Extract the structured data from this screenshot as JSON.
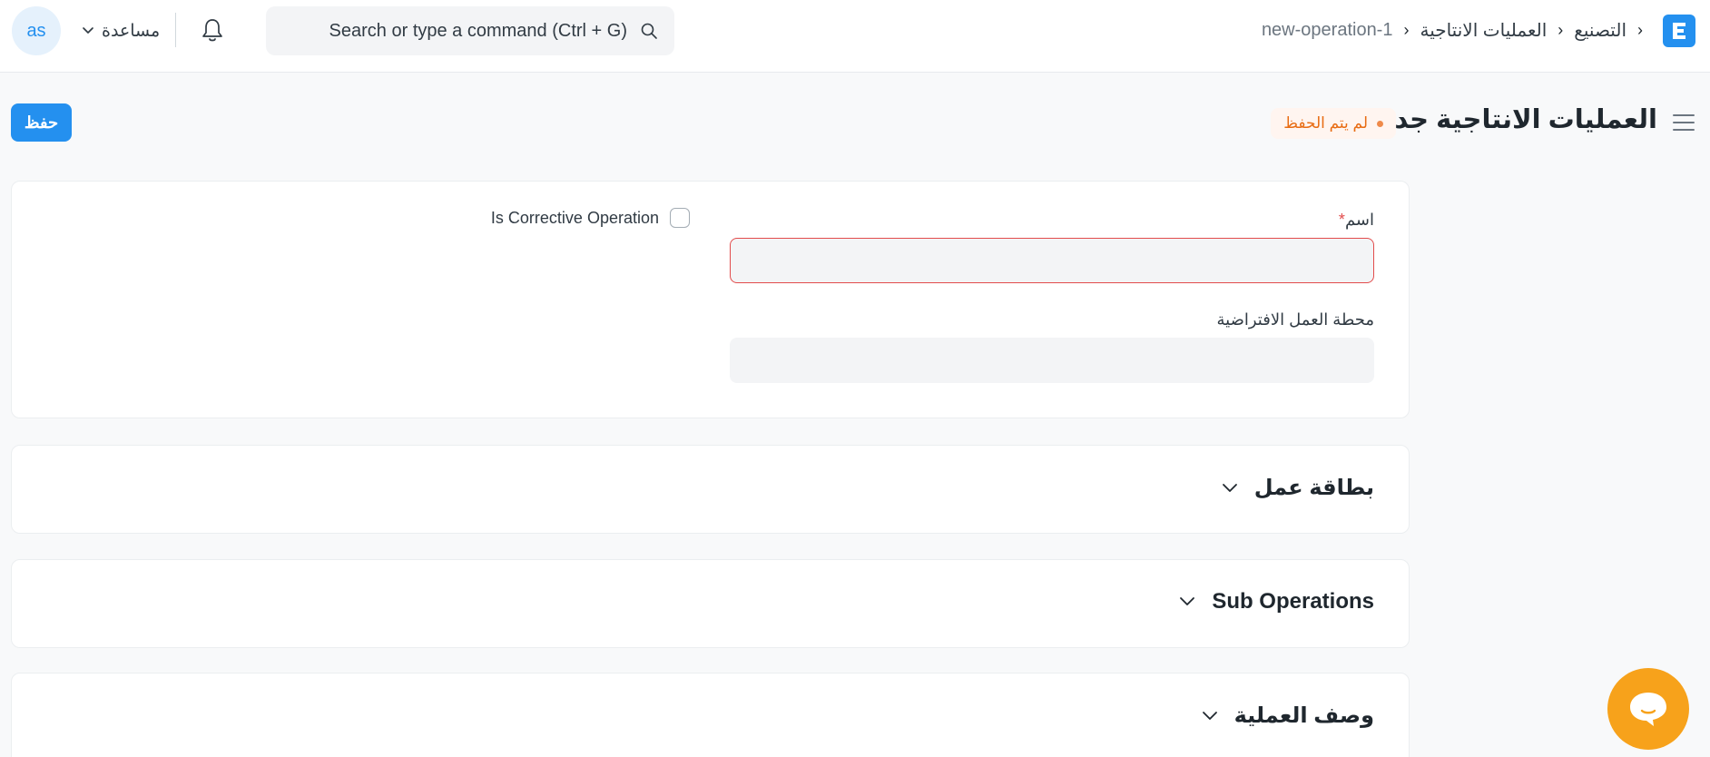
{
  "navbar": {
    "logo_letter": "E",
    "breadcrumb": [
      "التصنيع",
      "العمليات الانتاجية",
      "new-operation-1"
    ],
    "search_placeholder": "Search or type a command (Ctrl + G)",
    "help_label": "مساعدة",
    "avatar_initials": "as"
  },
  "page": {
    "title": "العمليات الانتاجية جديد",
    "status": "لم يتم الحفظ",
    "save_label": "حفظ"
  },
  "form": {
    "name_label": "اسم",
    "name_required_mark": "*",
    "name_value": "",
    "workstation_label": "محطة العمل الافتراضية",
    "workstation_value": "",
    "corrective_label": "Is Corrective Operation",
    "corrective_checked": false
  },
  "sections": [
    {
      "title": "بطاقة عمل"
    },
    {
      "title": "Sub Operations"
    },
    {
      "title": "وصف العملية"
    }
  ],
  "colors": {
    "primary": "#2490ef",
    "indicator": "#e86c13",
    "error": "#e24c4c",
    "chat": "#f7a21b"
  }
}
